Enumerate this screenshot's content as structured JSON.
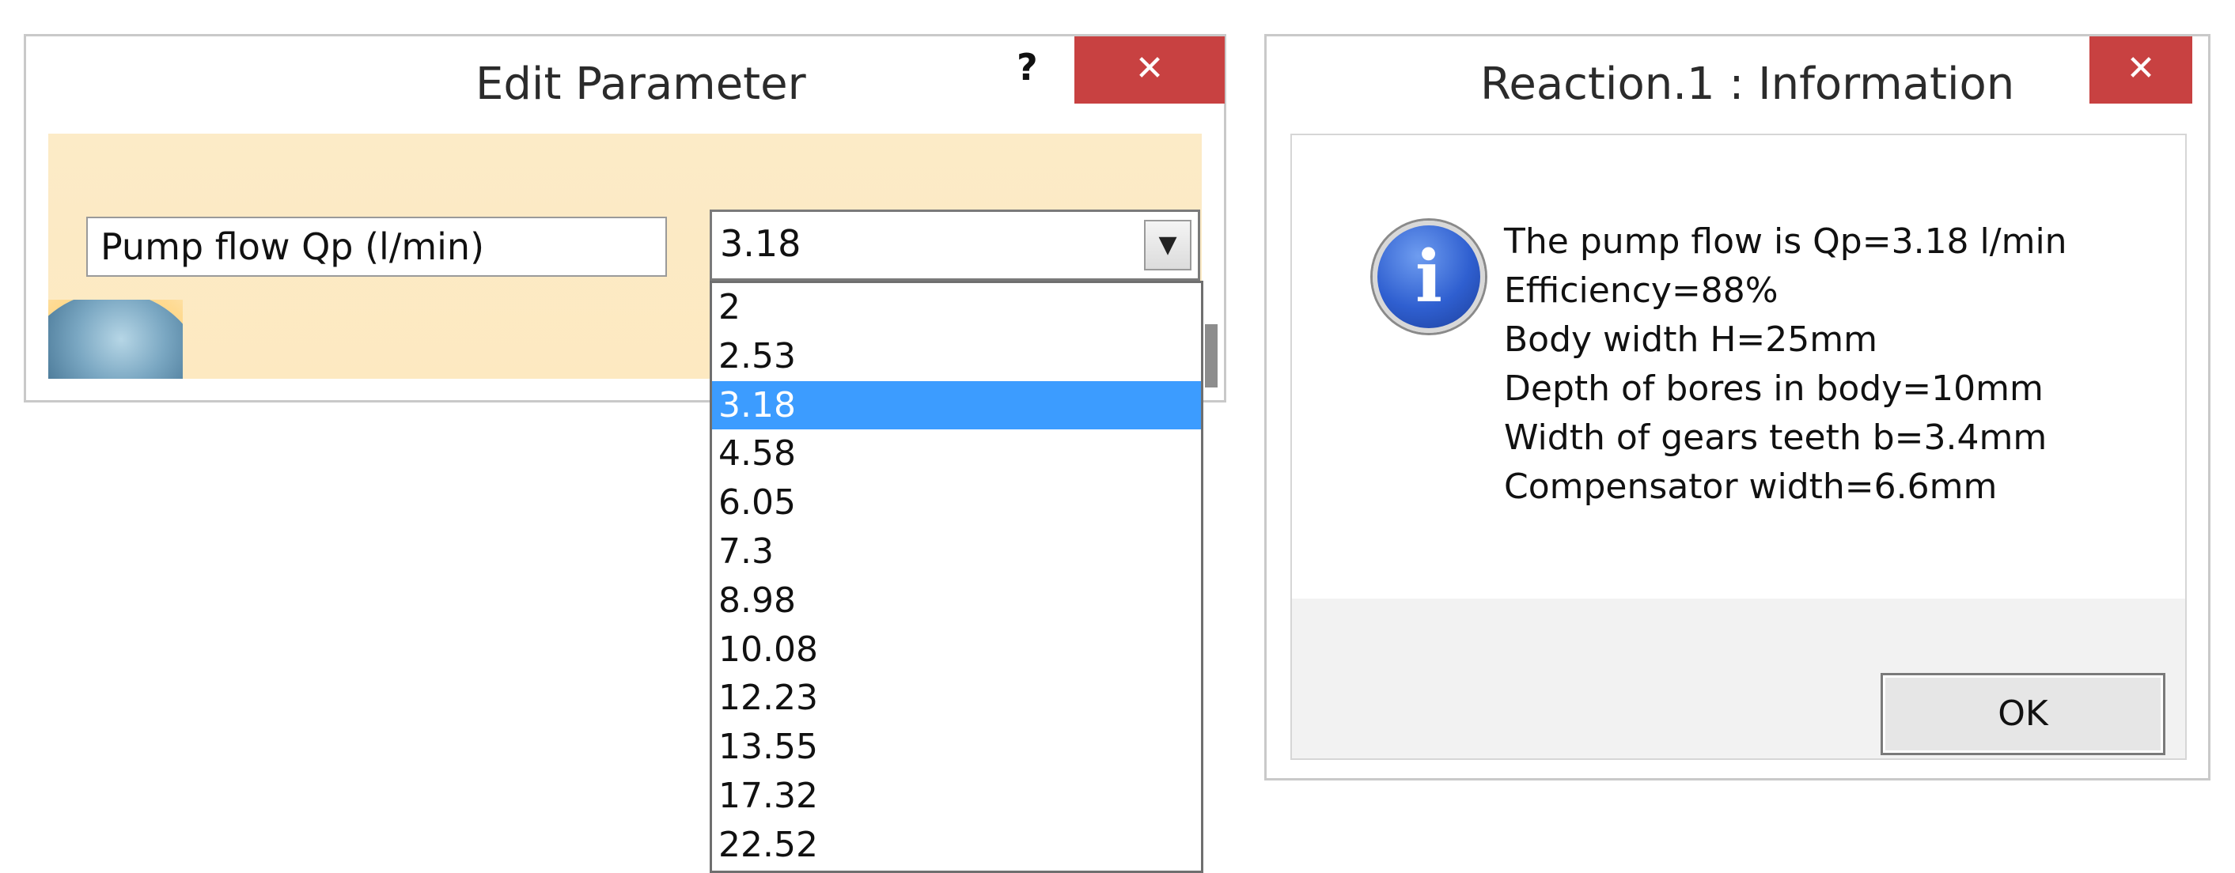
{
  "edit_dialog": {
    "title": "Edit Parameter",
    "help_label": "?",
    "close_label": "✕",
    "parameter_name": "Pump flow Qp (l/min)",
    "selected_value": "3.18",
    "dropdown_options": [
      "2",
      "2.53",
      "3.18",
      "4.58",
      "6.05",
      "7.3",
      "8.98",
      "10.08",
      "12.23",
      "13.55",
      "17.32",
      "22.52"
    ],
    "selected_index": 2,
    "icons": {
      "dropdown_arrow": "chevron-down-icon"
    }
  },
  "info_dialog": {
    "title": "Reaction.1 : Information",
    "close_label": "✕",
    "icon": "info-icon",
    "messages": [
      "The pump flow is Qp=3.18 l/min",
      "Efficiency=88%",
      "Body width H=25mm",
      "Depth of bores in body=10mm",
      "Width of gears teeth b=3.4mm",
      "Compensator width=6.6mm"
    ],
    "ok_label": "OK"
  },
  "colors": {
    "close_button": "#c84141",
    "selection": "#3c9cff",
    "panel": "#fcebc7"
  }
}
